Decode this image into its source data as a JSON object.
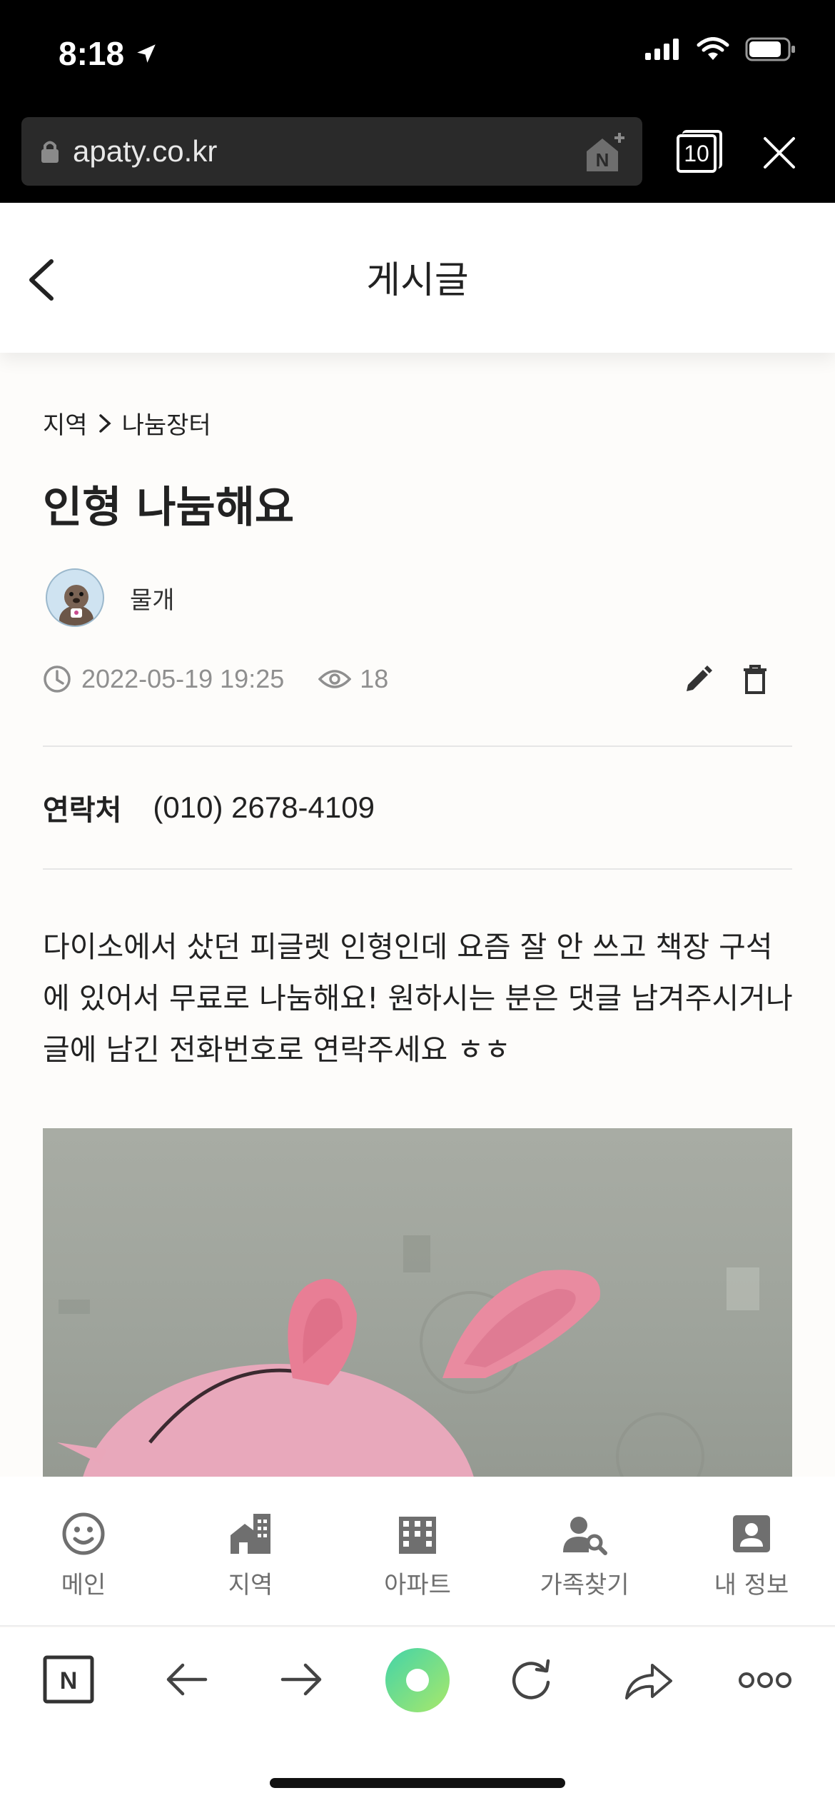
{
  "status_bar": {
    "time": "8:18"
  },
  "browser": {
    "url": "apaty.co.kr",
    "tab_count": "10"
  },
  "header": {
    "title": "게시글"
  },
  "post": {
    "breadcrumb": [
      "지역",
      "나눔장터"
    ],
    "title": "인형 나눔해요",
    "author": "물개",
    "date": "2022-05-19 19:25",
    "views": "18",
    "contact_label": "연락처",
    "contact_value": "(010) 2678-4109",
    "body": "다이소에서 샀던 피글렛 인형인데 요즘 잘 안 쓰고 책장 구석에 있어서 무료로 나눔해요! 원하시는 분은 댓글 남겨주시거나 글에 남긴 전화번호로 연락주세요 ㅎㅎ"
  },
  "app_nav": [
    {
      "label": "메인",
      "icon": "smile-icon"
    },
    {
      "label": "지역",
      "icon": "region-icon"
    },
    {
      "label": "아파트",
      "icon": "apartment-icon"
    },
    {
      "label": "가족찾기",
      "icon": "family-search-icon"
    },
    {
      "label": "내 정보",
      "icon": "profile-icon"
    }
  ],
  "colors": {
    "meta_gray": "#8f8f8f",
    "nav_gray": "#6f6f6f",
    "accent_green": "#5cd6a0"
  }
}
